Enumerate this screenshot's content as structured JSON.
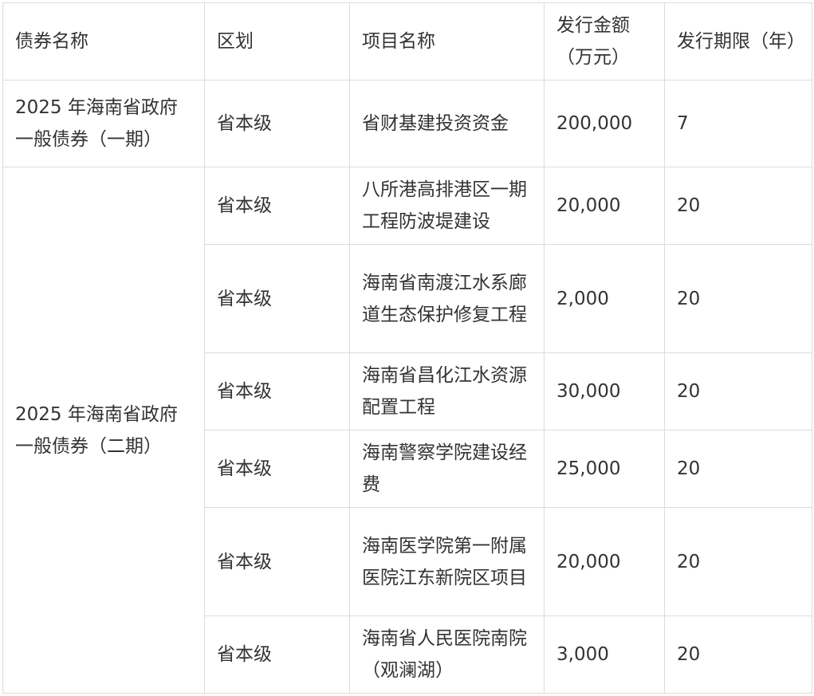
{
  "header": {
    "bond_name": "债券名称",
    "region": "区划",
    "project_name": "项目名称",
    "amount": "发行金额（万元）",
    "term": "发行期限（年）"
  },
  "groups": [
    {
      "bond_name": "2025 年海南省政府一般债券（一期）",
      "rows": [
        {
          "region": "省本级",
          "project": "省财基建投资资金",
          "amount": "200,000",
          "term": "7"
        }
      ]
    },
    {
      "bond_name": "2025 年海南省政府一般债券（二期）",
      "rows": [
        {
          "region": "省本级",
          "project": "八所港高排港区一期工程防波堤建设",
          "amount": "20,000",
          "term": "20"
        },
        {
          "region": "省本级",
          "project": "海南省南渡江水系廊道生态保护修复工程",
          "amount": "2,000",
          "term": "20"
        },
        {
          "region": "省本级",
          "project": "海南省昌化江水资源配置工程",
          "amount": "30,000",
          "term": "20"
        },
        {
          "region": "省本级",
          "project": "海南警察学院建设经费",
          "amount": "25,000",
          "term": "20"
        },
        {
          "region": "省本级",
          "project": "海南医学院第一附属医院江东新院区项目",
          "amount": "20,000",
          "term": "20"
        },
        {
          "region": "省本级",
          "project": "海南省人民医院南院（观澜湖）",
          "amount": "3,000",
          "term": "20"
        }
      ]
    }
  ]
}
